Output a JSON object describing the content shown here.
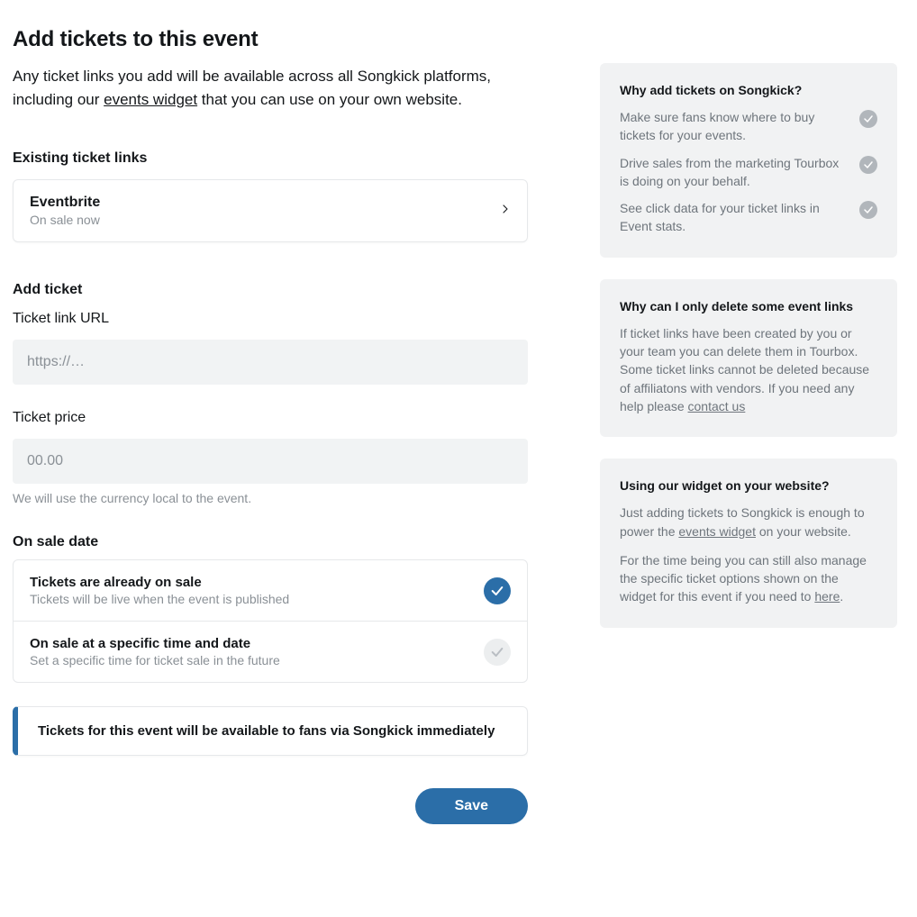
{
  "page": {
    "title": "Add tickets to this event",
    "intro_pre": "Any ticket links you add will be available across all Songkick platforms, including our ",
    "intro_link": "events widget",
    "intro_post": " that you can use on your own website."
  },
  "existing": {
    "heading": "Existing ticket links",
    "item": {
      "name": "Eventbrite",
      "status": "On sale now"
    }
  },
  "add": {
    "heading": "Add ticket",
    "url_label": "Ticket link URL",
    "url_placeholder": "https://…",
    "price_label": "Ticket price",
    "price_placeholder": "00.00",
    "price_helper": "We will use the currency local to the event."
  },
  "onsale": {
    "heading": "On sale date",
    "options": [
      {
        "title": "Tickets are already on sale",
        "desc": "Tickets will be live when the event is published",
        "selected": true
      },
      {
        "title": "On sale at a specific time and date",
        "desc": "Set a specific time for ticket sale in the future",
        "selected": false
      }
    ],
    "banner": "Tickets for this event will be available to fans via Songkick immediately"
  },
  "actions": {
    "save": "Save"
  },
  "info": {
    "why_add": {
      "title": "Why add tickets on Songkick?",
      "items": [
        "Make sure fans know where to buy tickets for your events.",
        "Drive sales from the marketing Tourbox is doing on your behalf.",
        "See click data for your ticket links in Event stats."
      ]
    },
    "delete": {
      "title": "Why can I only delete some event links",
      "body": "If ticket links have been created by you or your team you can delete them in Tourbox. Some ticket links cannot be deleted because of affiliatons with vendors. If you need any help please ",
      "link": "contact us"
    },
    "widget": {
      "title": "Using our widget on your website?",
      "p1_pre": "Just adding tickets to Songkick is enough to power the ",
      "p1_link": "events widget",
      "p1_post": " on your website.",
      "p2_pre": "For the time being you can still also manage the specific ticket options shown on the widget for this event if you need to ",
      "p2_link": "here",
      "p2_post": "."
    }
  }
}
